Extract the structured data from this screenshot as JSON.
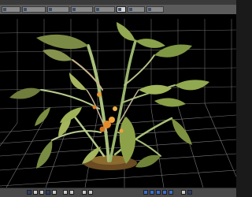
{
  "window": {
    "title": ""
  },
  "tabs": [
    {
      "label": "",
      "icon": "view-icon",
      "active": false
    },
    {
      "label": "",
      "icon": "grid-icon",
      "active": false
    },
    {
      "label": "",
      "icon": "render-icon",
      "active": false
    },
    {
      "label": "",
      "icon": "camera-icon",
      "active": false
    },
    {
      "label": "",
      "icon": "light-icon",
      "active": false
    },
    {
      "label": "",
      "icon": "plant-icon",
      "active": true
    },
    {
      "label": "",
      "icon": "settings-icon",
      "active": false
    },
    {
      "label": "",
      "icon": "preview-icon",
      "active": false
    }
  ],
  "viewport": {
    "subject": "3d-plant-model",
    "background_color": "#000000",
    "grid_color": "#9a9a9a"
  },
  "toolbar": {
    "buttons": [
      "select-tool-icon",
      "move-tool-icon",
      "rotate-tool-icon",
      "scale-tool-icon",
      "zoom-icon",
      "pan-icon",
      "orbit-icon",
      "camera-icon",
      "light-icon",
      "render-icon",
      "grid-toggle-icon",
      "settings-icon",
      "undo-icon",
      "redo-icon",
      "save-icon",
      "help-icon"
    ]
  }
}
